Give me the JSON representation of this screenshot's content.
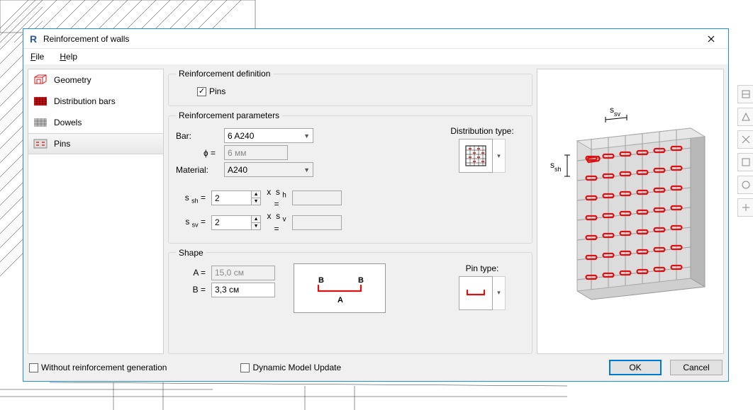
{
  "window": {
    "title": "Reinforcement of walls"
  },
  "menu": {
    "file": "File",
    "help": "Help"
  },
  "nav": {
    "geometry": "Geometry",
    "distribution_bars": "Distribution bars",
    "dowels": "Dowels",
    "pins": "Pins"
  },
  "definition": {
    "legend": "Reinforcement definition",
    "pins_check": "Pins"
  },
  "params": {
    "legend": "Reinforcement parameters",
    "bar_label": "Bar:",
    "bar_value": "6 A240",
    "diameter_label": "ɸ =",
    "diameter_value": "6 мм",
    "material_label": "Material:",
    "material_value": "A240",
    "ssh_label": "s",
    "ssh_sub": "sh",
    "ssh_value": "2",
    "sh_label": "s",
    "sh_sub": "h",
    "sh_value": "",
    "ssv_label": "s",
    "ssv_sub": "sv",
    "ssv_value": "2",
    "sv_label": "s",
    "sv_sub": "v",
    "sv_value": "",
    "dist_label": "Distribution type:"
  },
  "shape": {
    "legend": "Shape",
    "a_label": "A =",
    "a_value": "15,0 см",
    "b_label": "B =",
    "b_value": "3,3 см",
    "diag_a": "A",
    "diag_b": "B",
    "pin_label": "Pin type:"
  },
  "preview": {
    "ssv_label": "s",
    "ssv_sub": "sv",
    "ssh_label": "s",
    "ssh_sub": "sh"
  },
  "footer": {
    "without_gen": "Without reinforcement generation",
    "dynamic_update": "Dynamic Model Update",
    "ok": "OK",
    "cancel": "Cancel"
  }
}
